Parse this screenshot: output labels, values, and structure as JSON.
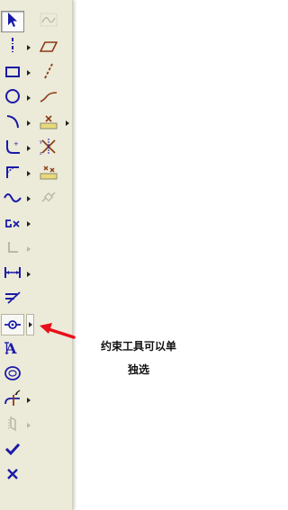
{
  "toolbar": {
    "left_column": [
      {
        "name": "select-pointer-icon",
        "state": "pressed",
        "flyout": false
      },
      {
        "name": "centerline-icon",
        "state": "normal",
        "flyout": true
      },
      {
        "name": "rectangle-icon",
        "state": "normal",
        "flyout": true
      },
      {
        "name": "circle-icon",
        "state": "normal",
        "flyout": true
      },
      {
        "name": "arc-icon",
        "state": "normal",
        "flyout": true
      },
      {
        "name": "fillet-icon",
        "state": "normal",
        "flyout": true
      },
      {
        "name": "chamfer-icon",
        "state": "normal",
        "flyout": true
      },
      {
        "name": "spline-icon",
        "state": "normal",
        "flyout": true
      },
      {
        "name": "point-icon",
        "state": "normal",
        "flyout": true
      },
      {
        "name": "corner-icon",
        "state": "disabled",
        "flyout": true
      },
      {
        "name": "dimension-icon",
        "state": "normal",
        "flyout": true
      },
      {
        "name": "offset-icon",
        "state": "normal",
        "flyout": false
      },
      {
        "name": "constraint-icon",
        "state": "hover",
        "flyout": true
      },
      {
        "name": "text-icon",
        "state": "normal",
        "flyout": false
      },
      {
        "name": "palette-icon",
        "state": "normal",
        "flyout": false
      },
      {
        "name": "trim-icon",
        "state": "normal",
        "flyout": true
      },
      {
        "name": "mirror-icon",
        "state": "disabled",
        "flyout": true
      },
      {
        "name": "check-icon",
        "state": "normal",
        "flyout": false
      },
      {
        "name": "cross-icon",
        "state": "normal",
        "flyout": false
      }
    ],
    "right_column": [
      {
        "name": "construction-curve-icon",
        "state": "disabled",
        "flyout": false
      },
      {
        "name": "parallelogram-icon",
        "state": "normal",
        "flyout": false
      },
      {
        "name": "dashed-line-icon",
        "state": "normal",
        "flyout": false
      },
      {
        "name": "curve-icon",
        "state": "normal",
        "flyout": false
      },
      {
        "name": "coordinate-system-icon",
        "state": "normal",
        "flyout": true
      },
      {
        "name": "modify-icon",
        "state": "normal",
        "flyout": false
      },
      {
        "name": "palette-points-icon",
        "state": "normal",
        "flyout": false
      },
      {
        "name": "link-icon",
        "state": "disabled",
        "flyout": false
      }
    ]
  },
  "annotation": {
    "line1": "约束工具可以单",
    "line2": "独选",
    "arrow_color": "#e8101a"
  },
  "colors": {
    "icon_blue": "#1a1aa8",
    "icon_brown": "#8b3a14",
    "disabled_gray": "#b8b8a8"
  }
}
